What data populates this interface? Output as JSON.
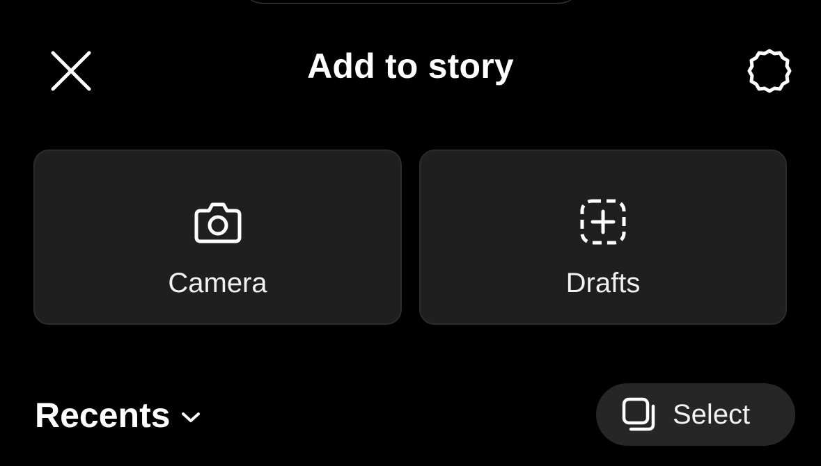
{
  "header": {
    "title": "Add to story",
    "close_icon": "close-icon",
    "settings_icon": "gear-icon"
  },
  "cards": {
    "camera": {
      "label": "Camera",
      "icon": "camera-icon"
    },
    "drafts": {
      "label": "Drafts",
      "icon": "dashed-plus-square-icon"
    }
  },
  "gallery": {
    "album_label": "Recents",
    "album_icon": "chevron-down-icon",
    "select_label": "Select",
    "select_icon": "multi-select-icon"
  },
  "colors": {
    "background": "#000000",
    "card_background": "#1f1f1f",
    "pill_background": "#262626",
    "text": "#ffffff"
  }
}
